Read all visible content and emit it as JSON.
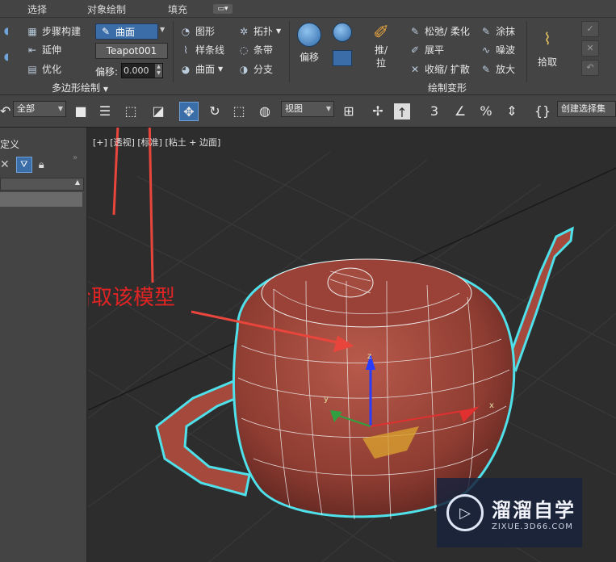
{
  "tabs": [
    "选择",
    "对象绘制",
    "填充"
  ],
  "ribbon": {
    "poly_group": {
      "items": [
        {
          "icon": "step-build-icon",
          "label": "步骤构建"
        },
        {
          "icon": "extend-icon",
          "label": "延伸"
        },
        {
          "icon": "optimize-icon",
          "label": "优化"
        }
      ],
      "surface_dropdown": "曲面",
      "target_object": "Teapot001",
      "offset_label": "偏移:",
      "offset_value": "0.000",
      "group_label": "多边形绘制"
    },
    "shape_tools": [
      {
        "icon": "shape-icon",
        "label": "图形"
      },
      {
        "icon": "spline-icon",
        "label": "样条线"
      },
      {
        "icon": "surface-icon",
        "label": "曲面"
      }
    ],
    "topology_tools": [
      {
        "icon": "topology-icon",
        "label": "拓扑"
      },
      {
        "icon": "strip-icon",
        "label": "条带"
      },
      {
        "icon": "branch-icon",
        "label": "分支"
      }
    ],
    "deform_group": {
      "offset_button": "偏移",
      "push_pull_button": "推/拉",
      "tools": [
        {
          "icon": "relax-icon",
          "label": "松弛/ 柔化"
        },
        {
          "icon": "flatten-icon",
          "label": "展平"
        },
        {
          "icon": "shrink-icon",
          "label": "收缩/ 扩散"
        },
        {
          "icon": "smudge-icon",
          "label": "涂抹"
        },
        {
          "icon": "noise-icon",
          "label": "噪波"
        },
        {
          "icon": "amplify-icon",
          "label": "放大"
        }
      ],
      "group_label": "绘制变形"
    },
    "pick_button": "拾取"
  },
  "toolbar": {
    "filter_select": "全部",
    "coord_select": "视图",
    "selection_set": "创建选择集"
  },
  "left_panel": {
    "title": "定义"
  },
  "viewport": {
    "label": "[+] [透视] [标准] [粘土 + 边面]",
    "annotation": "拾取该模型"
  },
  "watermark": {
    "name": "溜溜自学",
    "url": "ZIXUE.3D66.COM"
  },
  "colors": {
    "accent": "#3b6ea8",
    "teapot": "#a4493c",
    "selection_outline": "#4fe0ea",
    "annotation": "#e02424"
  }
}
